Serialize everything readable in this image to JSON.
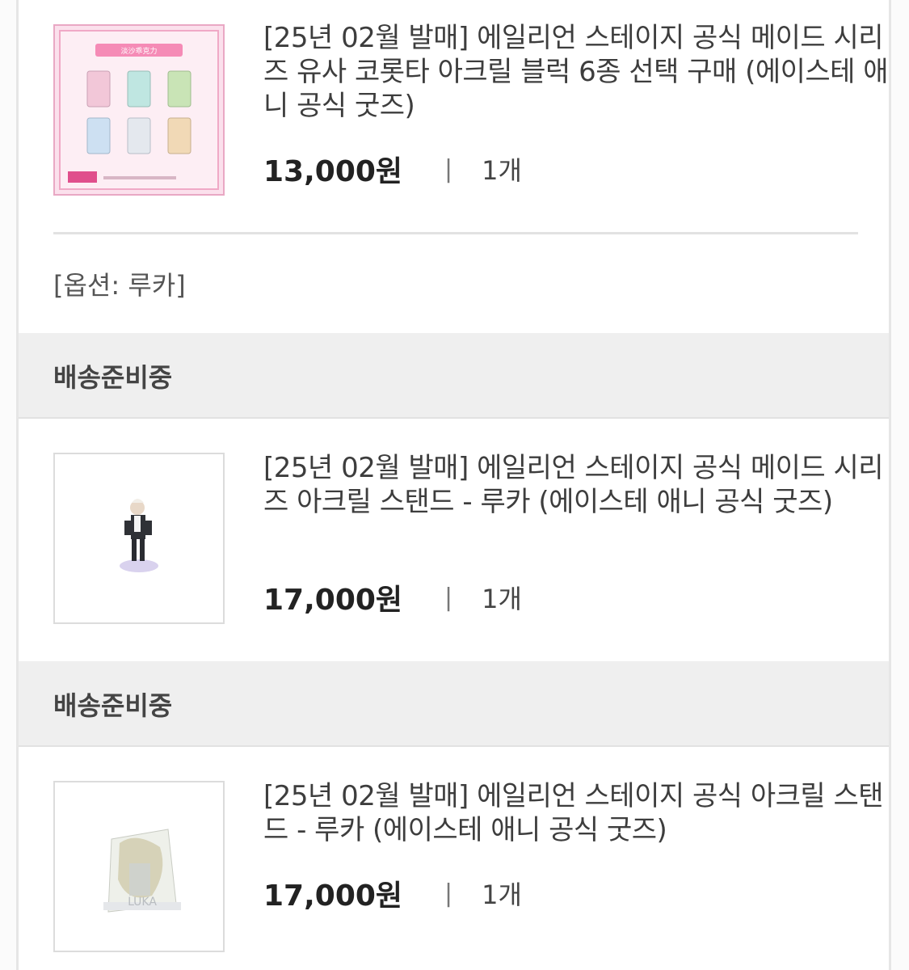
{
  "orders": [
    {
      "title": "[25년 02월 발매] 에일리언 스테이지 공식 메이드 시리즈 유사 코롯타 아크릴 블럭 6종 선택 구매 (에이스테 애니 공식 굿즈)",
      "price": "13,000원",
      "separator": "|",
      "quantity": "1개",
      "option": "[옵션: 루카]",
      "thumb_banner_text": "淡沙乖克力"
    },
    {
      "status": "배송준비중",
      "title": "[25년 02월 발매] 에일리언 스테이지 공식 메이드 시리즈 아크릴 스탠드 - 루카 (에이스테 애니 공식 굿즈)",
      "price": "17,000원",
      "separator": "|",
      "quantity": "1개"
    },
    {
      "status": "배송준비중",
      "title": "[25년 02월 발매] 에일리언 스테이지 공식 아크릴 스탠드 - 루카 (에이스테 애니 공식 굿즈)",
      "price": "17,000원",
      "separator": "|",
      "quantity": "1개",
      "thumb_watermark": "LUKA"
    }
  ],
  "colors": {
    "frame_border": "#e6e6e6",
    "status_bar": "#efefef",
    "price_text": "#222222",
    "thumb_pink": "#f6b7cf"
  }
}
